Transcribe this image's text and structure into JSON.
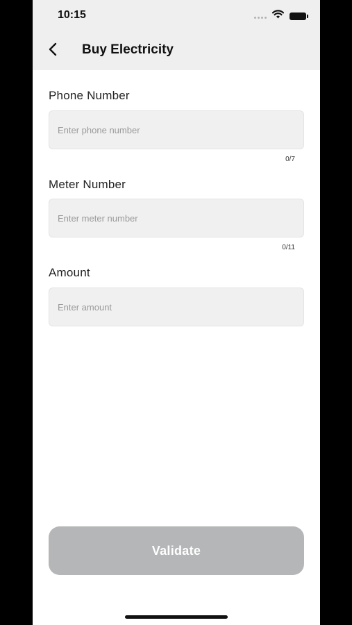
{
  "status_bar": {
    "time": "10:15",
    "icons": [
      "signal-icon",
      "wifi-icon",
      "battery-icon"
    ]
  },
  "header": {
    "back_icon": "chevron-left-icon",
    "title": "Buy Electricity"
  },
  "form": {
    "phone": {
      "label": "Phone Number",
      "placeholder": "Enter phone number",
      "value": "",
      "counter": "0/7"
    },
    "meter": {
      "label": "Meter Number",
      "placeholder": "Enter meter number",
      "value": "",
      "counter": "0/11"
    },
    "amount": {
      "label": "Amount",
      "placeholder": "Enter amount",
      "value": ""
    }
  },
  "actions": {
    "validate_label": "Validate"
  },
  "colors": {
    "header_bg": "#efeff0",
    "input_bg": "#f0f0f0",
    "button_disabled": "#b5b6b7"
  }
}
